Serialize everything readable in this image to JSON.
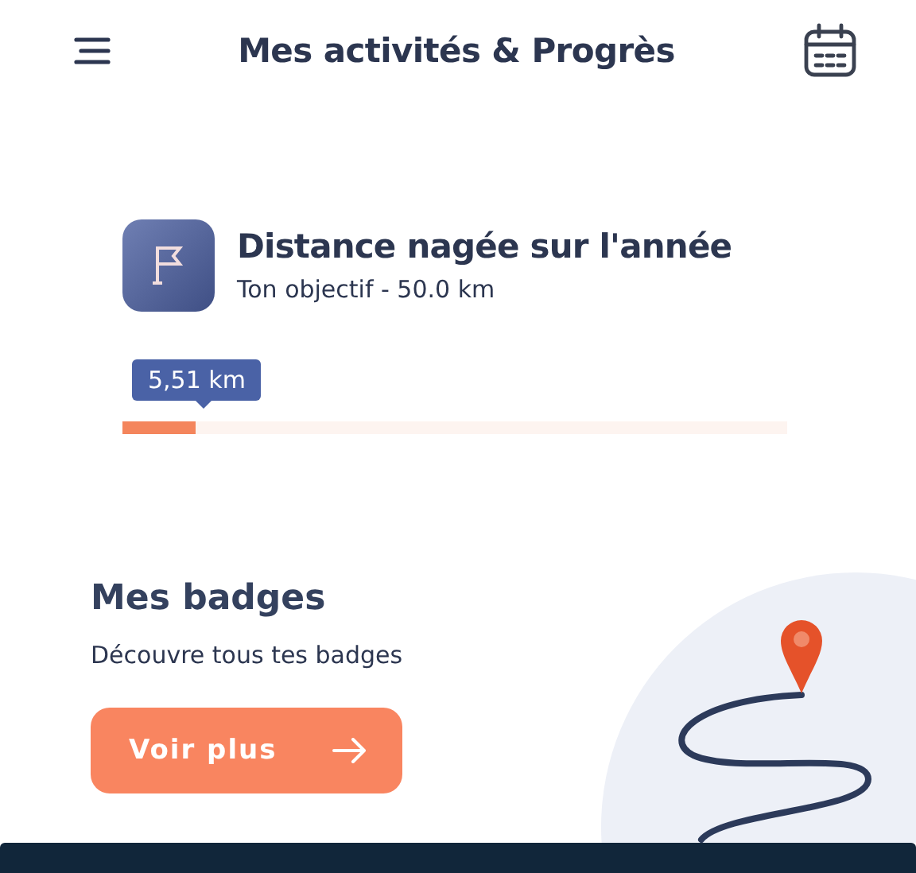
{
  "header": {
    "title": "Mes activités & Progrès"
  },
  "goal": {
    "title": "Distance nagée sur l'année",
    "subtitle": "Ton objectif - 50.0 km",
    "reading": "5,51 km",
    "level": 0.11
  },
  "badges": {
    "title": "Mes badges",
    "subtitle": "Découvre tous tes badges",
    "button": "Voir plus"
  }
}
